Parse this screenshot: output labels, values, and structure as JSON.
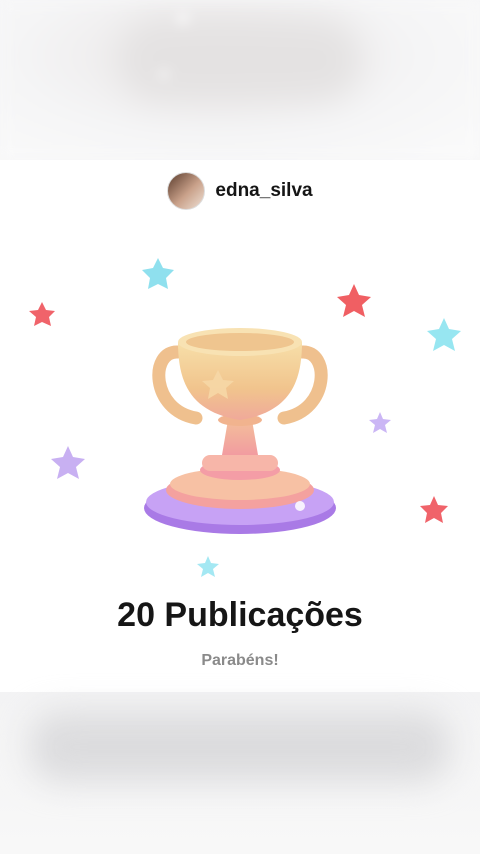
{
  "profile": {
    "username": "edna_silva",
    "avatar_icon": "avatar-photo"
  },
  "milestone": {
    "headline": "20 Publicações",
    "subtitle": "Parabéns!"
  },
  "art": {
    "icon": "trophy-icon",
    "colors": {
      "gold": "#f3cf94",
      "pink": "#f2a59c",
      "purple": "#b592ee",
      "star_red": "#f05c63",
      "star_cyan": "#8fe4f0",
      "star_violet": "#c8b2f3"
    }
  }
}
